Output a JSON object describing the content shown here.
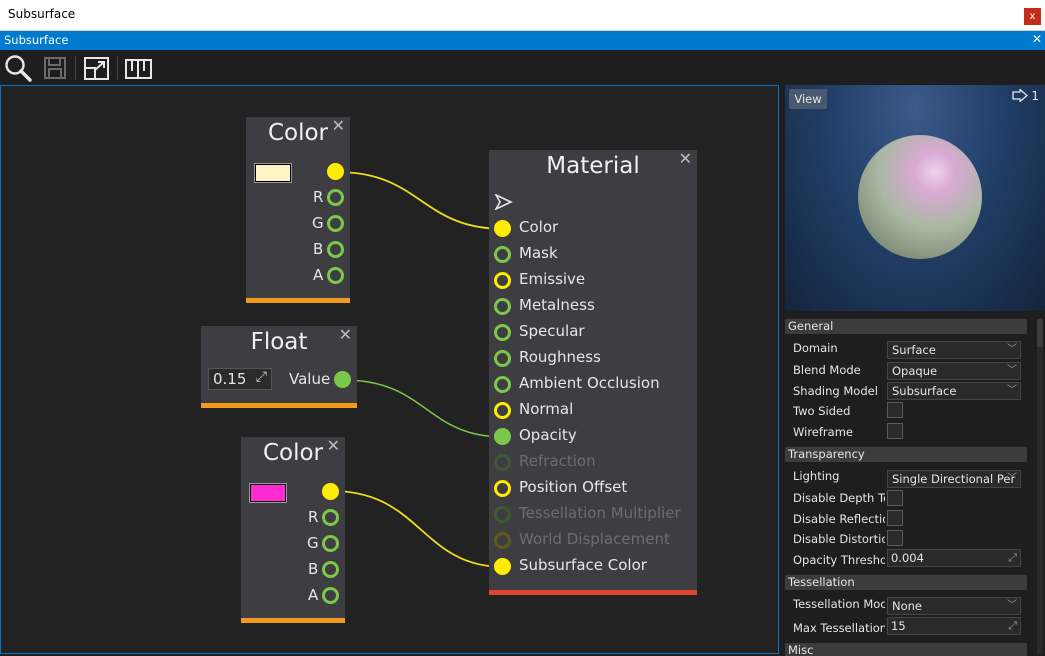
{
  "window": {
    "title": "Subsurface",
    "close_label": "x"
  },
  "tab": {
    "title": "Subsurface",
    "close_label": "✕"
  },
  "toolbar": {
    "icons": [
      "search-icon",
      "save-icon",
      "fit-view-icon",
      "docs-book-icon"
    ]
  },
  "nodes": {
    "color1": {
      "title": "Color",
      "close": "✕",
      "swatch_color": "#fff4c4",
      "pins": [
        "R",
        "G",
        "B",
        "A"
      ]
    },
    "float": {
      "title": "Float",
      "close": "✕",
      "value": "0.15",
      "edit_glyph": "⤢",
      "output_label": "Value"
    },
    "color2": {
      "title": "Color",
      "close": "✕",
      "swatch_color": "#ff2ad1",
      "pins": [
        "R",
        "G",
        "B",
        "A"
      ]
    },
    "material": {
      "title": "Material",
      "close": "✕",
      "inputs": [
        {
          "label": "Color"
        },
        {
          "label": "Mask"
        },
        {
          "label": "Emissive"
        },
        {
          "label": "Metalness"
        },
        {
          "label": "Specular"
        },
        {
          "label": "Roughness"
        },
        {
          "label": "Ambient Occlusion"
        },
        {
          "label": "Normal"
        },
        {
          "label": "Opacity"
        },
        {
          "label": "Refraction"
        },
        {
          "label": "Position Offset"
        },
        {
          "label": "Tessellation Multiplier"
        },
        {
          "label": "World Displacement"
        },
        {
          "label": "Subsurface Color"
        }
      ]
    }
  },
  "colors": {
    "accent": "#007acc",
    "node_bar": "#f29a1b",
    "material_bar": "#e0452e",
    "pin_yellow": "#ffec00",
    "pin_green": "#7bc84a"
  },
  "preview": {
    "view_label": "View",
    "count": "1"
  },
  "properties": {
    "general": {
      "header": "General",
      "domain_label": "Domain",
      "domain_value": "Surface",
      "blend_label": "Blend Mode",
      "blend_value": "Opaque",
      "shading_label": "Shading Model",
      "shading_value": "Subsurface",
      "two_sided_label": "Two Sided",
      "wireframe_label": "Wireframe"
    },
    "transparency": {
      "header": "Transparency",
      "lighting_label": "Lighting",
      "lighting_value": "Single Directional Per",
      "depth_label": "Disable Depth Te",
      "reflection_label": "Disable Reflectio",
      "distortion_label": "Disable Distortio",
      "opacity_label": "Opacity Thresho",
      "opacity_value": "0.004"
    },
    "tessellation": {
      "header": "Tessellation",
      "mode_label": "Tessellation Moc",
      "mode_value": "None",
      "max_label": "Max Tessellation",
      "max_value": "15"
    },
    "misc": {
      "header": "Misc"
    },
    "chevron": "﹀",
    "edit_glyph": "⤢"
  }
}
